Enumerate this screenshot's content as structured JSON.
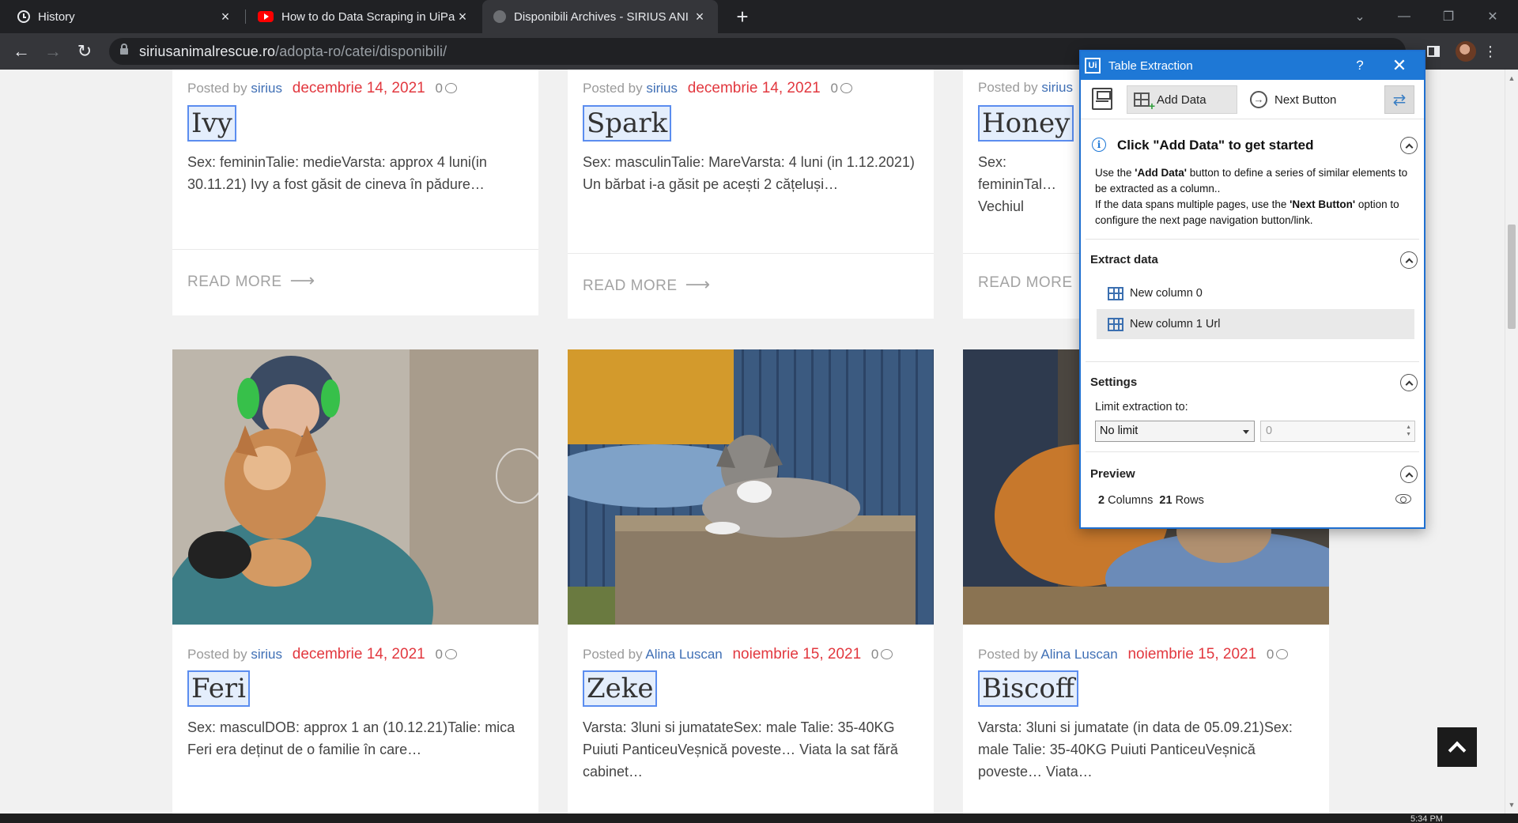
{
  "browser": {
    "tabs": [
      {
        "title": "History",
        "icon": "history-icon",
        "active": false
      },
      {
        "title": "How to do Data Scraping in UiPa",
        "icon": "youtube-icon",
        "active": false
      },
      {
        "title": "Disponibili Archives - SIRIUS ANI",
        "icon": "site-favicon",
        "active": true
      }
    ],
    "url_host": "siriusanimalrescue.ro",
    "url_path": "/adopta-ro/catei/disponibili/"
  },
  "page": {
    "posts_top": [
      {
        "posted_by": "Posted by",
        "author": "sirius",
        "date": "decembrie 14, 2021",
        "comments": "0",
        "title": "Ivy",
        "excerpt": "Sex: femininTalie: medieVarsta: approx 4 luni(in 30.11.21) Ivy a fost găsit de cineva în pădure…",
        "read_more": "READ MORE"
      },
      {
        "posted_by": "Posted by",
        "author": "sirius",
        "date": "decembrie 14, 2021",
        "comments": "0",
        "title": "Spark",
        "excerpt": "Sex: masculinTalie: MareVarsta: 4 luni (in 1.12.2021) Un bărbat i-a găsit pe acești 2 cățeluși…",
        "read_more": "READ MORE"
      },
      {
        "posted_by": "Posted by",
        "author": "sirius",
        "date": "",
        "comments": "",
        "title": "Honey",
        "excerpt": "Sex: femininTal… Vechiul nostru… stradă,…",
        "read_more": "READ MORE"
      }
    ],
    "posts_bottom": [
      {
        "posted_by": "Posted by",
        "author": "sirius",
        "date": "decembrie 14, 2021",
        "comments": "0",
        "title": "Feri",
        "excerpt": "Sex: masculDOB: approx 1 an (10.12.21)Talie: mica Feri era deținut de o familie în care…",
        "image": "woman-holding-tan-dog"
      },
      {
        "posted_by": "Posted by",
        "author": "Alina Luscan",
        "date": "noiembrie 15, 2021",
        "comments": "0",
        "title": "Zeke",
        "excerpt": "Varsta: 3luni si jumatateSex: male Talie: 35-40KG Puiuti PanticeuVeșnică poveste… Viata la sat fără cabinet…",
        "image": "grey-puppy-on-doghouse"
      },
      {
        "posted_by": "Posted by",
        "author": "Alina Luscan",
        "date": "noiembrie 15, 2021",
        "comments": "0",
        "title": "Biscoff",
        "excerpt": "Varsta: 3luni si jumatate (in data de 05.09.21)Sex: male Talie: 35-40KG Puiuti PanticeuVeșnică poveste… Viata…",
        "image": "puppy-on-lap"
      }
    ]
  },
  "dialog": {
    "title": "Table Extraction",
    "help_label": "?",
    "toolbar": {
      "add_data": "Add Data",
      "next_button": "Next Button"
    },
    "start": {
      "heading": "Click \"Add Data\" to get started",
      "line1_a": "Use the ",
      "line1_b": "'Add Data'",
      "line1_c": " button to define a series of similar elements to be extracted as a column..",
      "line2_a": "If the data spans multiple pages, use the ",
      "line2_b": "'Next Button'",
      "line2_c": " option to configure the next page navigation button/link."
    },
    "extract": {
      "heading": "Extract data",
      "columns": [
        "New column 0",
        "New column 1 Url"
      ]
    },
    "settings": {
      "heading": "Settings",
      "limit_label": "Limit extraction to:",
      "limit_value": "No limit",
      "limit_count": "0"
    },
    "preview": {
      "heading": "Preview",
      "columns_count": "2",
      "columns_label": "Columns",
      "rows_count": "21",
      "rows_label": "Rows"
    }
  },
  "taskbar": {
    "clock": "5:34 PM"
  }
}
